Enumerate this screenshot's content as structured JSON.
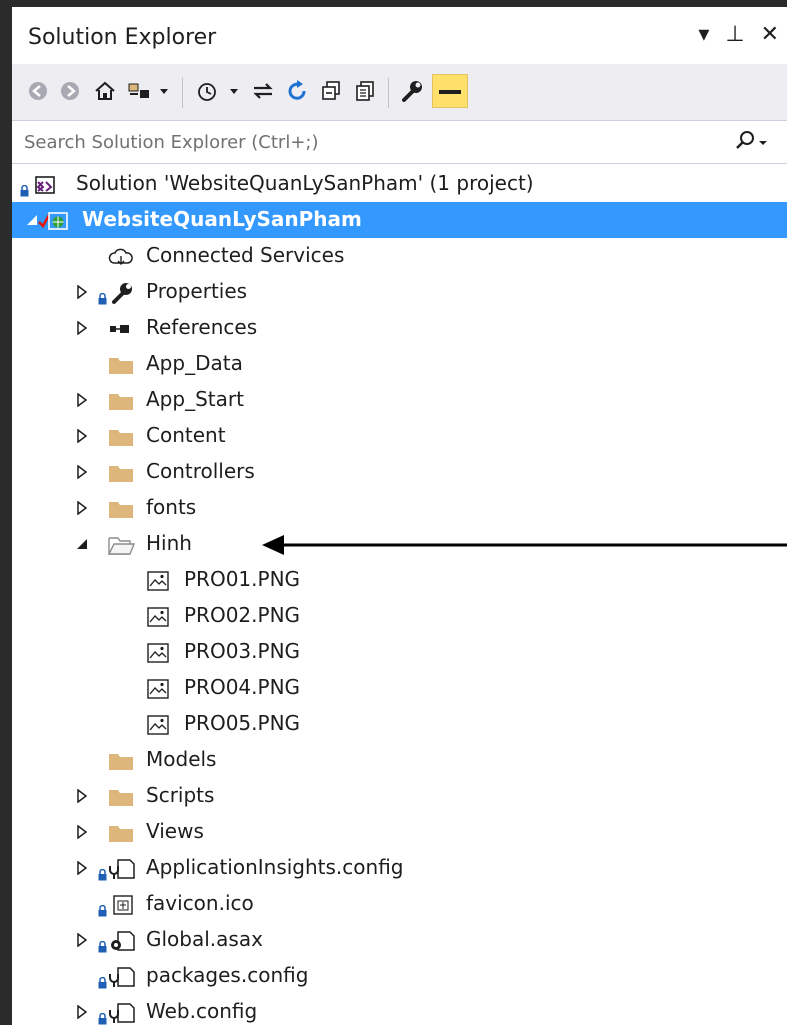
{
  "window": {
    "title": "Solution Explorer",
    "controls": [
      "▾",
      "⊥",
      "✕"
    ]
  },
  "toolbar": {
    "items": [
      "back-icon",
      "forward-icon",
      "home-icon",
      "switch-views-icon",
      "pending-changes-icon",
      "sync-icon",
      "refresh-icon",
      "collapse-all-icon",
      "show-all-files-icon",
      "properties-icon",
      "preview-selected-icon"
    ]
  },
  "search": {
    "placeholder": "Search Solution Explorer (Ctrl+;)"
  },
  "colors": {
    "selection": "#3399ff",
    "folder": "#dcb67a",
    "lock": "#1e5fb4",
    "frame": "#2b2b2b"
  },
  "tree": {
    "solution": "Solution 'WebsiteQuanLySanPham' (1 project)",
    "project": "WebsiteQuanLySanPham",
    "items": [
      {
        "label": "Connected Services",
        "icon": "cloud-icon",
        "level": 1,
        "expander": "none"
      },
      {
        "label": "Properties",
        "icon": "wrench-icon",
        "level": 1,
        "expander": "collapsed",
        "locked": true
      },
      {
        "label": "References",
        "icon": "references-icon",
        "level": 1,
        "expander": "collapsed"
      },
      {
        "label": "App_Data",
        "icon": "folder-icon",
        "level": 1,
        "expander": "none"
      },
      {
        "label": "App_Start",
        "icon": "folder-icon",
        "level": 1,
        "expander": "collapsed"
      },
      {
        "label": "Content",
        "icon": "folder-icon",
        "level": 1,
        "expander": "collapsed"
      },
      {
        "label": "Controllers",
        "icon": "folder-icon",
        "level": 1,
        "expander": "collapsed"
      },
      {
        "label": "fonts",
        "icon": "folder-icon",
        "level": 1,
        "expander": "collapsed"
      },
      {
        "label": "Hinh",
        "icon": "folder-open-icon",
        "level": 1,
        "expander": "expanded"
      },
      {
        "label": "PRO01.PNG",
        "icon": "image-icon",
        "level": 2,
        "expander": "none"
      },
      {
        "label": "PRO02.PNG",
        "icon": "image-icon",
        "level": 2,
        "expander": "none"
      },
      {
        "label": "PRO03.PNG",
        "icon": "image-icon",
        "level": 2,
        "expander": "none"
      },
      {
        "label": "PRO04.PNG",
        "icon": "image-icon",
        "level": 2,
        "expander": "none"
      },
      {
        "label": "PRO05.PNG",
        "icon": "image-icon",
        "level": 2,
        "expander": "none"
      },
      {
        "label": "Models",
        "icon": "folder-icon",
        "level": 1,
        "expander": "none"
      },
      {
        "label": "Scripts",
        "icon": "folder-icon",
        "level": 1,
        "expander": "collapsed"
      },
      {
        "label": "Views",
        "icon": "folder-icon",
        "level": 1,
        "expander": "collapsed"
      },
      {
        "label": "ApplicationInsights.config",
        "icon": "config-icon",
        "level": 1,
        "expander": "collapsed",
        "locked": true
      },
      {
        "label": "favicon.ico",
        "icon": "ico-file-icon",
        "level": 1,
        "expander": "none",
        "locked": true
      },
      {
        "label": "Global.asax",
        "icon": "asax-icon",
        "level": 1,
        "expander": "collapsed",
        "locked": true
      },
      {
        "label": "packages.config",
        "icon": "config-icon",
        "level": 1,
        "expander": "none",
        "locked": true
      },
      {
        "label": "Web.config",
        "icon": "config-icon",
        "level": 1,
        "expander": "collapsed",
        "locked": true
      }
    ]
  }
}
